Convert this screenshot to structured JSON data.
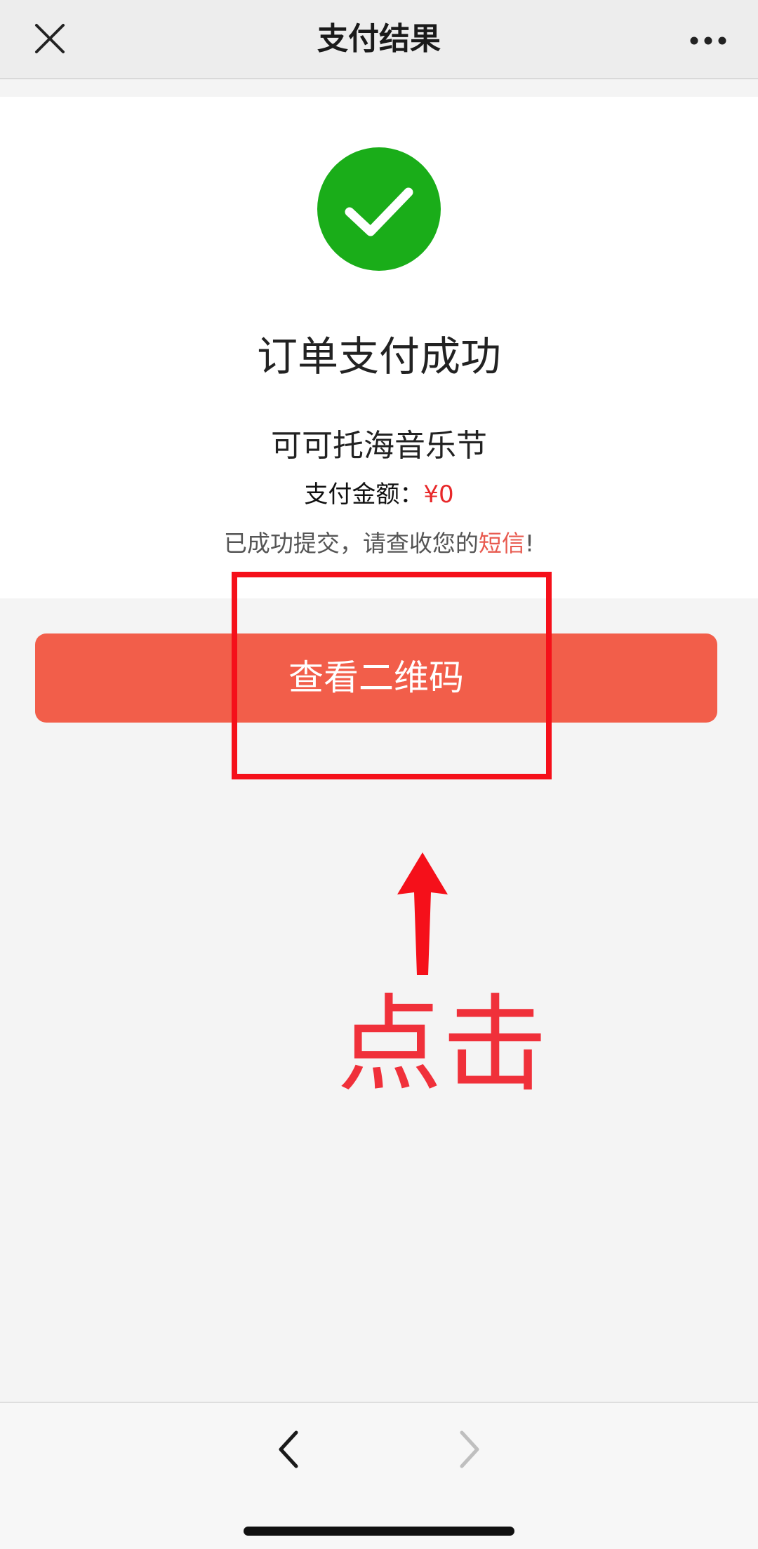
{
  "nav": {
    "title": "支付结果",
    "close_icon": "close-icon",
    "more_icon": "more-dots-icon"
  },
  "result": {
    "icon": "check-circle-icon",
    "icon_color": "#1aad19",
    "title": "订单支付成功",
    "event_name": "可可托海音乐节",
    "amount_label": "支付金额：",
    "amount_value": "¥0",
    "notice_prefix": "已成功提交，请查收您的",
    "notice_highlight": "短信",
    "notice_suffix": "!"
  },
  "primary_button": {
    "label": "查看二维码",
    "color": "#f25e4a"
  },
  "annotation": {
    "label": "点击",
    "color": "#f5101a"
  },
  "toolbar": {
    "back_icon": "chevron-left-icon",
    "forward_icon": "chevron-right-icon"
  }
}
